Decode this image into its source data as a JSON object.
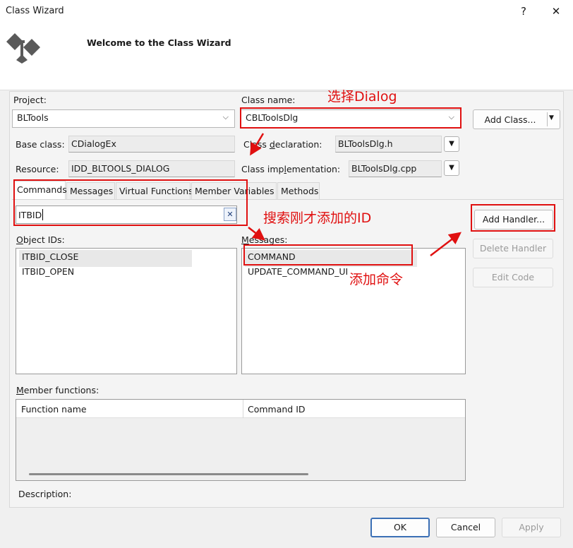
{
  "window": {
    "title": "Class Wizard",
    "help": "?",
    "close": "✕"
  },
  "header": {
    "welcome": "Welcome to the Class Wizard"
  },
  "project": {
    "label": "Project:",
    "value": "BLTools"
  },
  "class_name": {
    "label": "Class name:",
    "value": "CBLToolsDlg"
  },
  "add_class": "Add Class...",
  "base_class": {
    "label": "Base class:",
    "value": "CDialogEx"
  },
  "class_declaration": {
    "label": "Class declaration:",
    "value": "BLToolsDlg.h"
  },
  "resource": {
    "label": "Resource:",
    "value": "IDD_BLTOOLS_DIALOG"
  },
  "class_implementation": {
    "label": "Class implementation:",
    "value": "BLToolsDlg.cpp"
  },
  "tabs": [
    "Commands",
    "Messages",
    "Virtual Functions",
    "Member Variables",
    "Methods"
  ],
  "search": {
    "value": "ITBID",
    "clear": "✕"
  },
  "object_ids": {
    "label": "Object IDs:",
    "items": [
      "ITBID_CLOSE",
      "ITBID_OPEN"
    ]
  },
  "messages": {
    "label": "Messages:",
    "items": [
      "COMMAND",
      "UPDATE_COMMAND_UI"
    ]
  },
  "buttons": {
    "add_handler": "Add Handler...",
    "delete_handler": "Delete Handler",
    "edit_code": "Edit Code"
  },
  "member_functions": {
    "label": "Member functions:",
    "columns": [
      "Function name",
      "Command ID"
    ]
  },
  "description": {
    "label": "Description:"
  },
  "footer": {
    "ok": "OK",
    "cancel": "Cancel",
    "apply": "Apply"
  },
  "annotations": {
    "select_dialog": "选择Dialog",
    "search_id": "搜索刚才添加的ID",
    "add_command": "添加命令"
  },
  "colors": {
    "annotation": "#e01010",
    "panel": "#f4f4f4"
  }
}
